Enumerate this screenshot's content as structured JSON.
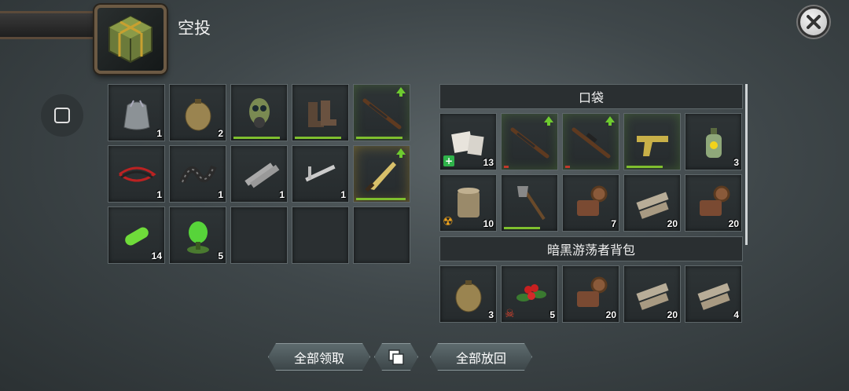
{
  "header": {
    "title": "空投",
    "crate_icon": "airdrop-crate-icon"
  },
  "close": {
    "icon": "close-x-icon"
  },
  "side": {
    "icon": "square-icon"
  },
  "loot": [
    {
      "name": "plastic-bag",
      "icon": "plastic-bag-icon",
      "count": "1"
    },
    {
      "name": "canteen",
      "icon": "canteen-icon",
      "count": "2"
    },
    {
      "name": "gas-mask",
      "icon": "gas-mask-icon",
      "count": "",
      "durability": 0.9
    },
    {
      "name": "boots",
      "icon": "boots-icon",
      "count": "",
      "durability": 0.9
    },
    {
      "name": "rifle",
      "icon": "rifle-icon",
      "count": "",
      "upgrade": true,
      "glow": "green",
      "durability": 0.9
    },
    {
      "name": "wires",
      "icon": "wires-icon",
      "count": "1"
    },
    {
      "name": "hose",
      "icon": "hose-icon",
      "count": "1"
    },
    {
      "name": "saw-blades",
      "icon": "saw-blade-icon",
      "count": "1"
    },
    {
      "name": "caliper",
      "icon": "caliper-icon",
      "count": "1"
    },
    {
      "name": "machete",
      "icon": "machete-icon",
      "count": "",
      "upgrade": true,
      "glow": "gold",
      "durability": 0.95
    },
    {
      "name": "green-capsule",
      "icon": "green-capsule-icon",
      "count": "14"
    },
    {
      "name": "green-flask",
      "icon": "green-flask-icon",
      "count": "5"
    },
    {
      "name": "empty"
    },
    {
      "name": "empty"
    },
    {
      "name": "empty"
    }
  ],
  "pocket": {
    "title": "口袋",
    "items": [
      {
        "name": "bandage",
        "icon": "bandage-icon",
        "count": "13",
        "badge": "med"
      },
      {
        "name": "rifle",
        "icon": "rifle-icon",
        "count": "",
        "upgrade": true,
        "glow": "green",
        "low": true
      },
      {
        "name": "sniper-rifle",
        "icon": "sniper-rifle-icon",
        "count": "",
        "upgrade": true,
        "glow": "green",
        "low": true
      },
      {
        "name": "golden-pistol",
        "icon": "pistol-icon",
        "count": "",
        "glow": "green",
        "durability": 0.7
      },
      {
        "name": "toxin-bottle",
        "icon": "toxin-bottle-icon",
        "count": "3"
      },
      {
        "name": "canned-food",
        "icon": "canned-food-icon",
        "count": "10",
        "badge": "rad"
      },
      {
        "name": "shovel",
        "icon": "shovel-icon",
        "count": "",
        "durability": 0.7
      },
      {
        "name": "rusty-parts",
        "icon": "rusty-parts-icon",
        "count": "7"
      },
      {
        "name": "planks",
        "icon": "planks-icon",
        "count": "20"
      },
      {
        "name": "rusty-parts",
        "icon": "rusty-parts-icon",
        "count": "20"
      }
    ]
  },
  "backpack": {
    "title": "暗黑游荡者背包",
    "items": [
      {
        "name": "canteen",
        "icon": "canteen-icon",
        "count": "3"
      },
      {
        "name": "berries",
        "icon": "berries-icon",
        "count": "5",
        "badge": "skull"
      },
      {
        "name": "rusty-parts",
        "icon": "rusty-parts-icon",
        "count": "20"
      },
      {
        "name": "planks",
        "icon": "planks-icon",
        "count": "20"
      },
      {
        "name": "planks",
        "icon": "planks-icon",
        "count": "4"
      }
    ]
  },
  "buttons": {
    "take_all": "全部领取",
    "stack_icon": "stack-icon",
    "return_all": "全部放回"
  }
}
